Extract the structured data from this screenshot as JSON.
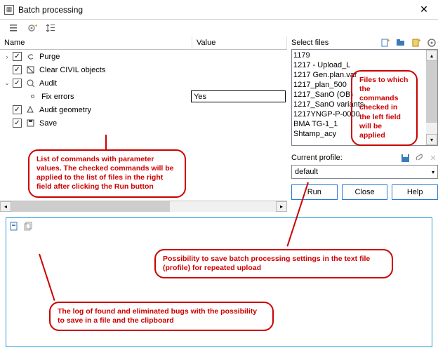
{
  "window": {
    "title": "Batch processing",
    "close_glyph": "✕"
  },
  "toolbar": {
    "expand_icon": "≡",
    "gear_icon": "⚙",
    "collapse_icon": "↕"
  },
  "grid": {
    "name_header": "Name",
    "value_header": "Value"
  },
  "commands": {
    "purge": {
      "label": "Purge",
      "checked": true,
      "expander": "›"
    },
    "clear_civil": {
      "label": "Clear CIVIL objects",
      "checked": true
    },
    "audit": {
      "label": "Audit",
      "checked": true,
      "expander": "⌄"
    },
    "fix_errors": {
      "label": "Fix errors",
      "value": "Yes"
    },
    "audit_geom": {
      "label": "Audit geometry",
      "checked": true
    },
    "save": {
      "label": "Save",
      "checked": true
    }
  },
  "files": {
    "label": "Select files",
    "items": [
      "1179",
      "1217 - Upload_L",
      "1217 Gen.plan.var",
      "1217_plan_500",
      "1217_SanO (OB)",
      "1217_SanO variants",
      "1217YNGP-P-0000",
      "BMA TG-1_1",
      "Shtamp_acy"
    ]
  },
  "profile": {
    "label": "Current profile:",
    "value": "default"
  },
  "buttons": {
    "run": "Run",
    "close": "Close",
    "help": "Help"
  },
  "annotations": {
    "files_note": "Files to which the commands checked in the left field will be applied",
    "commands_note": "List of commands with parameter values. The checked commands will be applied to the list of files in the right field after clicking the Run button",
    "profile_note": "Possibility to save batch processing settings in the text file (profile) for repeated upload",
    "log_note": "The log of found and eliminated bugs with the possibility to save in a file and the clipboard"
  },
  "colors": {
    "accent": "#2a7ad4",
    "anno": "#c00000"
  }
}
